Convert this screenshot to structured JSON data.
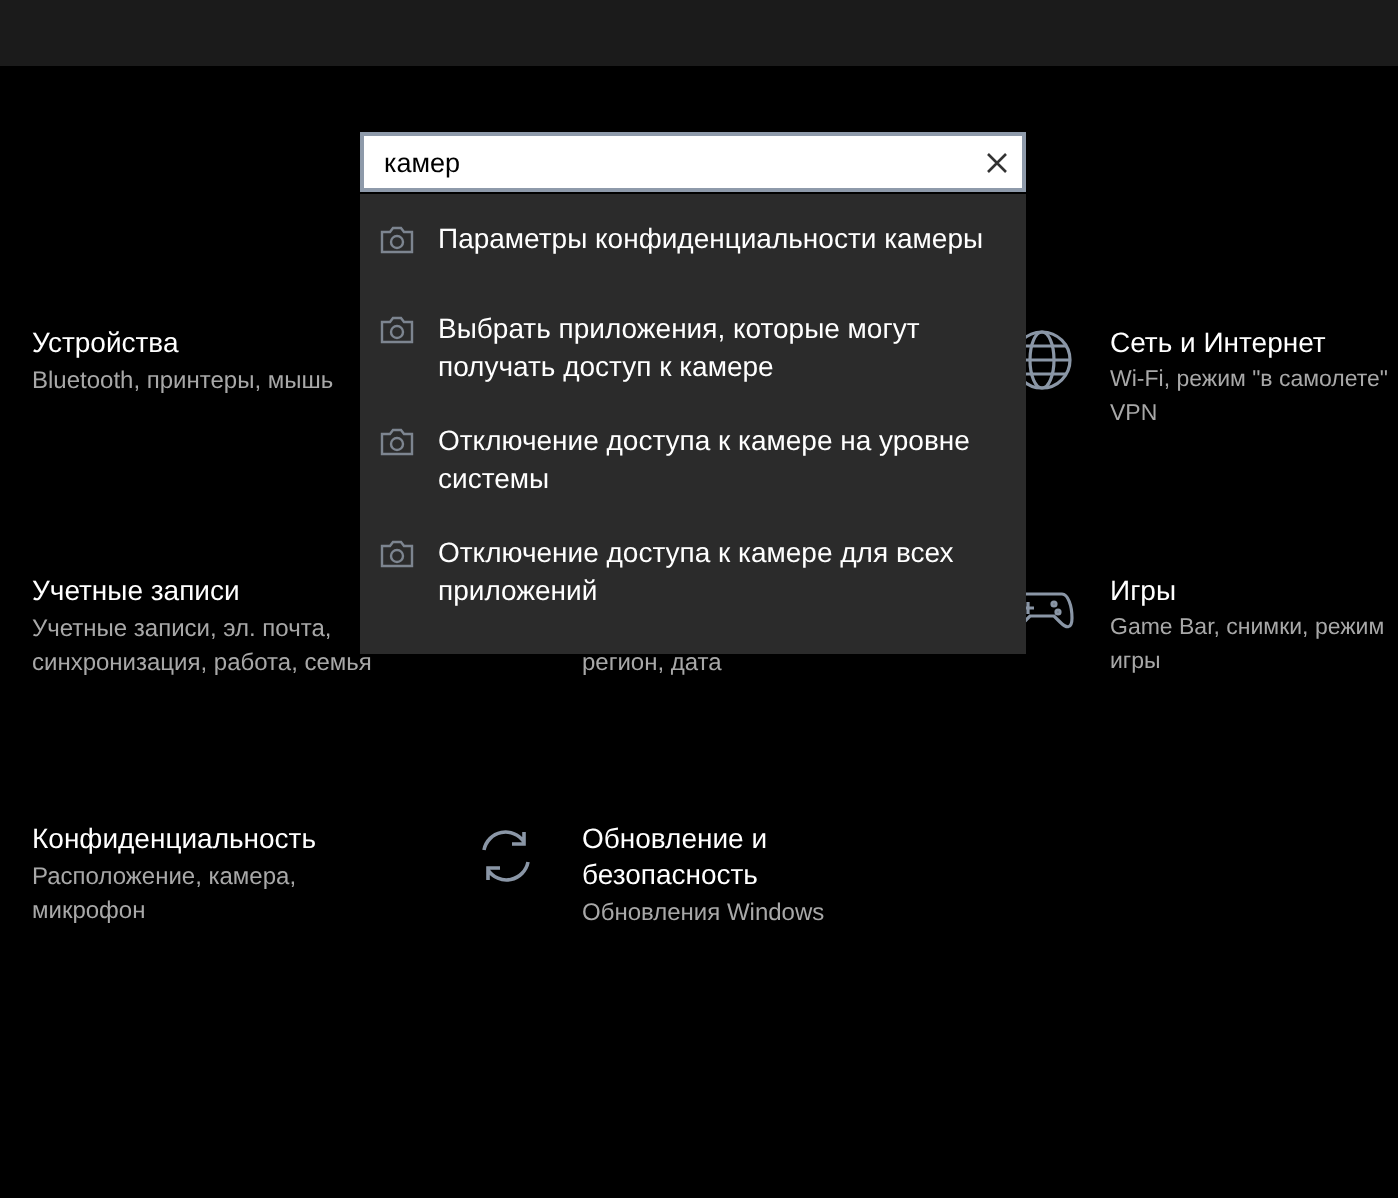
{
  "search": {
    "value": "камер"
  },
  "suggestions": [
    {
      "text": "Параметры конфиденциальности камеры"
    },
    {
      "text": "Выбрать приложения, которые могут получать доступ к камере"
    },
    {
      "text": "Отключение доступа к камере на уровне системы"
    },
    {
      "text": "Отключение доступа к камере для всех приложений"
    }
  ],
  "tiles": [
    {
      "kind": "plain",
      "title": "Устройства",
      "description": "Bluetooth, принтеры, мышь"
    },
    {
      "kind": "hidden"
    },
    {
      "kind": "globe",
      "title": "Сеть и Интернет",
      "description": "Wi-Fi, режим \"в самолете\" VPN"
    },
    {
      "kind": "plain",
      "title": "Учетные записи",
      "description": "Учетные записи, эл. почта, синхронизация, работа, семья"
    },
    {
      "kind": "covered",
      "description": "регион, дата"
    },
    {
      "kind": "gamepad",
      "title": "Игры",
      "description": "Game Bar, снимки, режим игры"
    },
    {
      "kind": "plain",
      "title": "Конфиденциальность",
      "description": "Расположение, камера, микрофон"
    },
    {
      "kind": "sync",
      "title": "Обновление и безопасность",
      "description": "Обновления Windows"
    }
  ]
}
